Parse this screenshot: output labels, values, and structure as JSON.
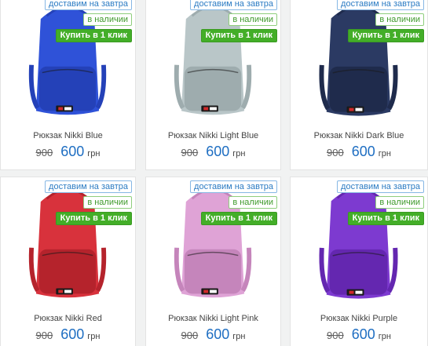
{
  "products": [
    {
      "name": "Рюкзак Nikki Blue",
      "old_price": "900",
      "price": "600",
      "currency": "грн",
      "delivery": "доставим на завтра",
      "stock": "в наличии",
      "buy": "Купить в 1 клик",
      "color": "#2f52d8",
      "shade": "#2441b8"
    },
    {
      "name": "Рюкзак Nikki Light Blue",
      "old_price": "900",
      "price": "600",
      "currency": "грн",
      "delivery": "доставим на завтра",
      "stock": "в наличии",
      "buy": "Купить в 1 клик",
      "color": "#b9c6c8",
      "shade": "#9eacae"
    },
    {
      "name": "Рюкзак Nikki Dark Blue",
      "old_price": "900",
      "price": "600",
      "currency": "грн",
      "delivery": "доставим на завтра",
      "stock": "в наличии",
      "buy": "Купить в 1 клик",
      "color": "#2b3a63",
      "shade": "#1f2b4c"
    },
    {
      "name": "Рюкзак Nikki Red",
      "old_price": "900",
      "price": "600",
      "currency": "грн",
      "delivery": "доставим на завтра",
      "stock": "в наличии",
      "buy": "Купить в 1 клик",
      "color": "#d8323c",
      "shade": "#b5232c"
    },
    {
      "name": "Рюкзак Nikki Light Pink",
      "old_price": "900",
      "price": "600",
      "currency": "грн",
      "delivery": "доставим на завтра",
      "stock": "в наличии",
      "buy": "Купить в 1 клик",
      "color": "#dfa3d6",
      "shade": "#c585bb"
    },
    {
      "name": "Рюкзак Nikki Purple",
      "old_price": "900",
      "price": "600",
      "currency": "грн",
      "delivery": "доставим на завтра",
      "stock": "в наличии",
      "buy": "Купить в 1 клик",
      "color": "#7d3ad0",
      "shade": "#6427b0"
    }
  ]
}
